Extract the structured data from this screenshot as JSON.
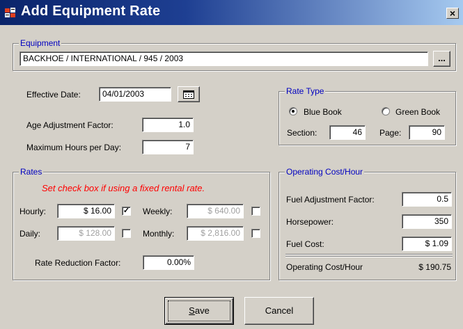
{
  "window": {
    "title": "Add Equipment Rate",
    "close_label": "×"
  },
  "equipment": {
    "legend": "Equipment",
    "value": "BACKHOE / INTERNATIONAL / 945 / 2003",
    "browse_label": "..."
  },
  "general": {
    "effective_date_label": "Effective Date:",
    "effective_date": "04/01/2003",
    "age_factor_label": "Age Adjustment Factor:",
    "age_factor": "1.0",
    "max_hours_label": "Maximum Hours per Day:",
    "max_hours": "7"
  },
  "rate_type": {
    "legend": "Rate Type",
    "blue_book_label": "Blue Book",
    "green_book_label": "Green Book",
    "selected": "Blue Book",
    "section_label": "Section:",
    "section": "46",
    "page_label": "Page:",
    "page": "90"
  },
  "rates": {
    "legend": "Rates",
    "note": "Set check box if using a fixed rental rate.",
    "hourly_label": "Hourly:",
    "hourly": "$ 16.00",
    "hourly_checked": true,
    "weekly_label": "Weekly:",
    "weekly": "$ 640.00",
    "weekly_checked": false,
    "daily_label": "Daily:",
    "daily": "$ 128.00",
    "daily_checked": false,
    "monthly_label": "Monthly:",
    "monthly": "$ 2,816.00",
    "monthly_checked": false,
    "reduction_label": "Rate Reduction Factor:",
    "reduction": "0.00%",
    "check_mark": "✓"
  },
  "operating_cost": {
    "legend": "Operating Cost/Hour",
    "fuel_factor_label": "Fuel Adjustment Factor:",
    "fuel_factor": "0.5",
    "horsepower_label": "Horsepower:",
    "horsepower": "350",
    "fuel_cost_label": "Fuel Cost:",
    "fuel_cost": "$ 1.09",
    "total_label": "Operating Cost/Hour",
    "total": "$ 190.75"
  },
  "buttons": {
    "save_label": "Save",
    "save_accel": "S",
    "save_rest": "ave",
    "cancel_label": "Cancel"
  }
}
